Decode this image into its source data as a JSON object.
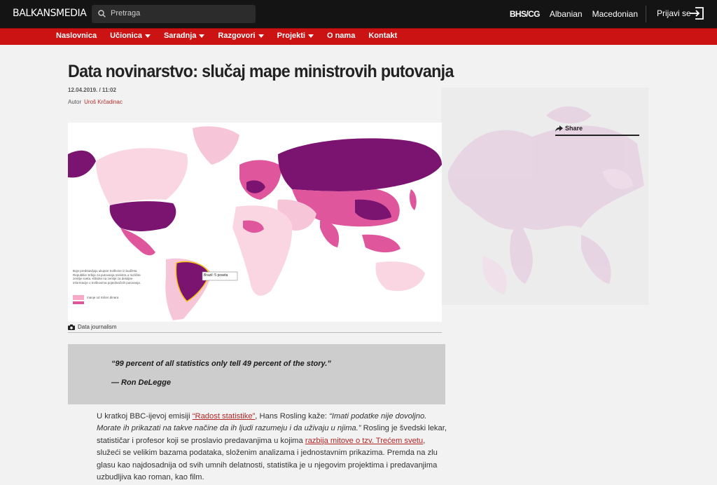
{
  "header": {
    "logo": "BALKANSMEDIA",
    "search_placeholder": "Pretraga",
    "languages": [
      "BHS/CG",
      "Albanian",
      "Macedonian"
    ],
    "login_label": "Prijavi se"
  },
  "nav": {
    "items": [
      {
        "label": "Naslovnica",
        "dropdown": false
      },
      {
        "label": "Učionica",
        "dropdown": true
      },
      {
        "label": "Saradnja",
        "dropdown": true
      },
      {
        "label": "Razgovori",
        "dropdown": true
      },
      {
        "label": "Projekti",
        "dropdown": true
      },
      {
        "label": "O nama",
        "dropdown": false
      },
      {
        "label": "Kontakt",
        "dropdown": false
      }
    ]
  },
  "article": {
    "title": "Data novinarstvo: slučaj mape ministrovih putovanja",
    "date": "12.04.2019. / 11:02",
    "author_label": "Autor",
    "author_name": "Uroš Krčadinac",
    "share_label": "Share",
    "image_caption": "Data journalism",
    "map_tooltip": "Brazil: 5 poseta",
    "map_legend_text": "Boje predstavljaju ukupne troškove iz budžeta Republike Srbije za putovanja ministra u različite zemlje sveta. Kliknite na zemlje za detaljne informacije o troškovima pojedinačnih putovanja.",
    "map_legend_scale": "manje od milion dinara",
    "quote_text": "“99 percent of all statistics only tell 49 percent of the story.”",
    "quote_author": "— Ron DeLegge",
    "body": {
      "l1a": "U kratkoj BBC-ijevoj emisiji ",
      "l1link": "“Radost statistike”",
      "l1b": ", Hans Rosling kaže: ",
      "l1c": "“Imati podatke nije dovoljno.",
      "l2a": "Morate ih prikazati na takve načine da ih ljudi razumeju i da uživaju u njima.”",
      "l2b": " Rosling je švedski lekar,",
      "l3a": "statističar i profesor koji se proslavio predavanjima u kojima ",
      "l3link": "razbija mitove o tzv. Trećem svetu",
      "l3b": ",",
      "l4": "služeći se velikim bazama podataka, složenim analizama i jednostavnim prikazima. Premda na zlu",
      "l5": "glasu kao najdosadnija od svih umnih delatnosti, statistika je u njegovim projektima i predavanjima",
      "l6": "uzbudljiva kao roman, kao film."
    }
  },
  "colors": {
    "topbar": "#141414",
    "navbar": "#cc1313",
    "accent_link": "#b32525",
    "map_dark": "#7a1470",
    "map_mid": "#e0569c",
    "map_light": "#f7c5d8"
  }
}
